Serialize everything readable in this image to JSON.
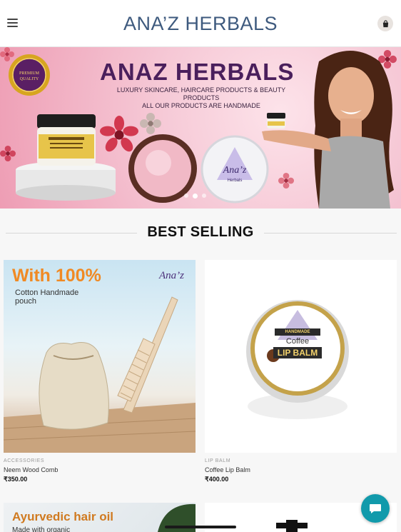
{
  "header": {
    "brand": "ANA’Z HERBALS",
    "menu_icon": "hamburger-menu-icon",
    "cart_icon": "shopping-bag-icon"
  },
  "hero": {
    "title": "ANAZ HERBALS",
    "subtitle_line1": "LUXURY SKINCARE, HAIRCARE PRODUCTS & BEAUTY PRODUCTS",
    "subtitle_line2": "ALL OUR PRODUCTS ARE HANDMADE",
    "badge_line1": "PREMIUM",
    "badge_line2": "QUALITY",
    "jar_logo": "Ana’z",
    "jar_logo_sub": "Herbals",
    "slide_count": 3,
    "active_slide": 2
  },
  "section": {
    "title": "BEST SELLING"
  },
  "products": [
    {
      "category": "ACCESSORIES",
      "name": "Neem Wood Comb",
      "price": "₹350.00",
      "image_headline": "With 100%",
      "image_caption_line1": "Cotton Handmade",
      "image_caption_line2": "pouch",
      "image_logo": "Ana’z"
    },
    {
      "category": "LIP BALM",
      "name": "Coffee Lip Balm",
      "price": "₹400.00",
      "image_label_top": "HANDMADE",
      "image_label_mid": "Coffee",
      "image_label_main": "LIP BALM"
    }
  ],
  "row2": {
    "left_headline": "Ayurvedic hair oil",
    "left_caption": "Made with organic"
  },
  "colors": {
    "brand": "#3e5a7e",
    "hero_title": "#4a1f5c",
    "chat": "#119aab"
  },
  "chat_icon": "chat-bubble-icon"
}
